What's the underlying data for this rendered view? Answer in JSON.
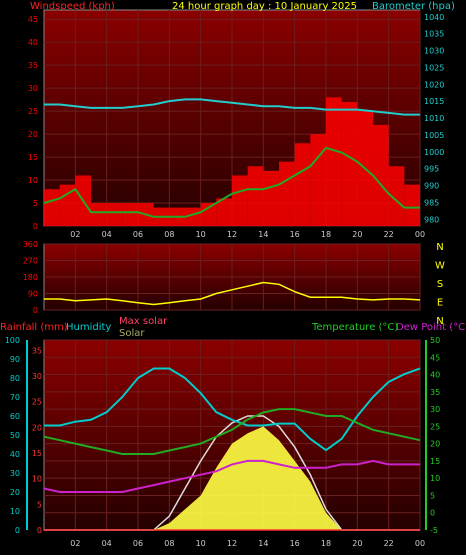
{
  "title": "24 hour graph day : 10 January 2025",
  "colors": {
    "bg": "#000000",
    "panel_top": "#8b0000",
    "panel_bottom": "#2a0000",
    "grid": "#6a2020",
    "wind": "#ff0000",
    "gust_avg": "#22aa22",
    "baro": "#22cccc",
    "dir": "#ffff00",
    "rain": "#ff3333",
    "humidity": "#00cccc",
    "temp": "#22aa22",
    "dew": "#cc22cc",
    "solar": "#ffff44",
    "maxsolar": "#dddddd",
    "dir_labels": "#ffff00"
  },
  "x_ticks": [
    "02",
    "04",
    "06",
    "08",
    "10",
    "12",
    "14",
    "16",
    "18",
    "20",
    "22",
    "00"
  ],
  "chart_data": [
    {
      "type": "line",
      "name": "wind-baro",
      "left_axis_label": "Windspeed (kph)",
      "right_axis_label": "Barometer (hpa)",
      "left_ticks": [
        "0",
        "5",
        "10",
        "15",
        "20",
        "25",
        "30",
        "35",
        "40",
        "45"
      ],
      "right_ticks": [
        "980",
        "985",
        "990",
        "995",
        "1000",
        "1005",
        "1010",
        "1015",
        "1020",
        "1025",
        "1030",
        "1035",
        "1040"
      ],
      "ylim_left": [
        0,
        47
      ],
      "ylim_right": [
        978,
        1042
      ],
      "x": [
        0,
        1,
        2,
        3,
        4,
        5,
        6,
        7,
        8,
        9,
        10,
        11,
        12,
        13,
        14,
        15,
        16,
        17,
        18,
        19,
        20,
        21,
        22,
        23,
        24
      ],
      "series": [
        {
          "role": "wind",
          "values": [
            8,
            9,
            11,
            5,
            5,
            5,
            5,
            4,
            4,
            4,
            5,
            6,
            11,
            13,
            12,
            14,
            18,
            20,
            28,
            27,
            25,
            22,
            13,
            9,
            9
          ]
        },
        {
          "role": "avg",
          "values": [
            5,
            6,
            8,
            3,
            3,
            3,
            3,
            2,
            2,
            2,
            3,
            5,
            7,
            8,
            8,
            9,
            11,
            13,
            17,
            16,
            14,
            11,
            7,
            4,
            4
          ]
        },
        {
          "role": "baro",
          "values": [
            1014,
            1014,
            1013.5,
            1013,
            1013,
            1013,
            1013.5,
            1014,
            1015,
            1015.5,
            1015.5,
            1015,
            1014.5,
            1014,
            1013.5,
            1013.5,
            1013,
            1013,
            1012.5,
            1012.5,
            1012.5,
            1012,
            1011.5,
            1011,
            1011
          ]
        }
      ]
    },
    {
      "type": "line",
      "name": "wind-direction",
      "left_ticks": [
        "0",
        "90",
        "180",
        "270",
        "360"
      ],
      "right_labels": [
        "N",
        "W",
        "S",
        "E",
        "N"
      ],
      "ylim": [
        0,
        360
      ],
      "x": [
        0,
        1,
        2,
        3,
        4,
        5,
        6,
        7,
        8,
        9,
        10,
        11,
        12,
        13,
        14,
        15,
        16,
        17,
        18,
        19,
        20,
        21,
        22,
        23,
        24
      ],
      "values": [
        60,
        60,
        50,
        55,
        60,
        50,
        40,
        30,
        40,
        50,
        60,
        90,
        110,
        130,
        150,
        140,
        100,
        70,
        70,
        70,
        60,
        55,
        60,
        60,
        55
      ]
    },
    {
      "type": "area",
      "name": "rain-humidity-temp-solar",
      "legend": [
        "Rainfall (mm)",
        "Humidity",
        "Max solar",
        "Solar",
        "Temperature (°C)",
        "Dew Point (°C)"
      ],
      "rain_ticks": [
        "0",
        "5",
        "10",
        "15",
        "20",
        "25",
        "30",
        "35"
      ],
      "humidity_ticks": [
        "0",
        "10",
        "20",
        "30",
        "40",
        "50",
        "60",
        "70",
        "80",
        "90",
        "100"
      ],
      "temp_ticks": [
        "-5",
        "0",
        "5",
        "10",
        "15",
        "20",
        "25",
        "30",
        "35",
        "40",
        "45",
        "50"
      ],
      "humidity_ylim": [
        0,
        100
      ],
      "temp_ylim": [
        -5,
        50
      ],
      "x": [
        0,
        1,
        2,
        3,
        4,
        5,
        6,
        7,
        8,
        9,
        10,
        11,
        12,
        13,
        14,
        15,
        16,
        17,
        18,
        19,
        20,
        21,
        22,
        23,
        24
      ],
      "series": [
        {
          "role": "humidity",
          "values": [
            55,
            55,
            57,
            58,
            62,
            70,
            80,
            85,
            85,
            80,
            72,
            62,
            58,
            55,
            55,
            56,
            56,
            48,
            42,
            48,
            60,
            70,
            78,
            82,
            85
          ]
        },
        {
          "role": "temp",
          "values": [
            22,
            21,
            20,
            19,
            18,
            17,
            17,
            17,
            18,
            19,
            20,
            22,
            24,
            27,
            29,
            30,
            30,
            29,
            28,
            28,
            26,
            24,
            23,
            22,
            21
          ]
        },
        {
          "role": "dew",
          "values": [
            7,
            6,
            6,
            6,
            6,
            6,
            7,
            8,
            9,
            10,
            11,
            12,
            14,
            15,
            15,
            14,
            13,
            13,
            13,
            14,
            14,
            15,
            14,
            14,
            14
          ]
        },
        {
          "role": "maxsolar",
          "values": [
            0,
            0,
            0,
            0,
            0,
            0,
            0,
            0,
            4,
            12,
            20,
            27,
            31,
            33,
            33,
            30,
            24,
            16,
            6,
            0,
            0,
            0,
            0,
            0,
            0
          ]
        },
        {
          "role": "solar",
          "values": [
            0,
            0,
            0,
            0,
            0,
            0,
            0,
            0,
            2,
            6,
            10,
            18,
            25,
            28,
            30,
            26,
            20,
            14,
            5,
            0,
            0,
            0,
            0,
            0,
            0
          ]
        },
        {
          "role": "rain",
          "values": [
            0,
            0,
            0,
            0,
            0,
            0,
            0,
            0,
            0,
            0,
            0,
            0,
            0,
            0,
            0,
            0,
            0,
            0,
            0,
            0,
            0,
            0,
            0,
            0,
            0
          ]
        }
      ]
    }
  ]
}
